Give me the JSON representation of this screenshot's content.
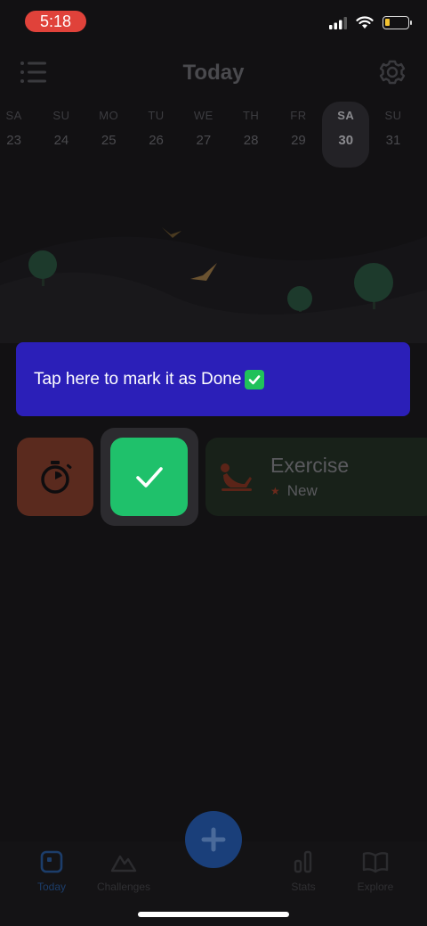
{
  "status_bar": {
    "time": "5:18",
    "battery_level": 0.2,
    "battery_color": "#f2c230"
  },
  "header": {
    "title": "Today",
    "menu_icon": "list-icon",
    "settings_icon": "gear-icon"
  },
  "week": [
    {
      "abbr": "SA",
      "num": "23",
      "selected": false
    },
    {
      "abbr": "SU",
      "num": "24",
      "selected": false
    },
    {
      "abbr": "MO",
      "num": "25",
      "selected": false
    },
    {
      "abbr": "TU",
      "num": "26",
      "selected": false
    },
    {
      "abbr": "WE",
      "num": "27",
      "selected": false
    },
    {
      "abbr": "TH",
      "num": "28",
      "selected": false
    },
    {
      "abbr": "FR",
      "num": "29",
      "selected": false
    },
    {
      "abbr": "SA",
      "num": "30",
      "selected": true
    },
    {
      "abbr": "SU",
      "num": "31",
      "selected": false
    }
  ],
  "tooltip": {
    "text": "Tap here to mark it as Done",
    "emoji_icon": "check-mark-button-icon",
    "background": "#2b1fb8"
  },
  "habit": {
    "name": "Exercise",
    "badge": "New",
    "timer_icon": "stopwatch-icon",
    "done_icon": "checkmark-icon",
    "habit_icon": "sit-up-icon",
    "done_color": "#1fc16b"
  },
  "tabbar": {
    "tabs": [
      {
        "label": "Today",
        "icon": "calendar-today-icon",
        "active": true
      },
      {
        "label": "Challenges",
        "icon": "mountain-icon",
        "active": false
      },
      {
        "label": "Stats",
        "icon": "bar-chart-icon",
        "active": false
      },
      {
        "label": "Explore",
        "icon": "open-book-icon",
        "active": false
      }
    ],
    "fab_icon": "plus-icon"
  }
}
